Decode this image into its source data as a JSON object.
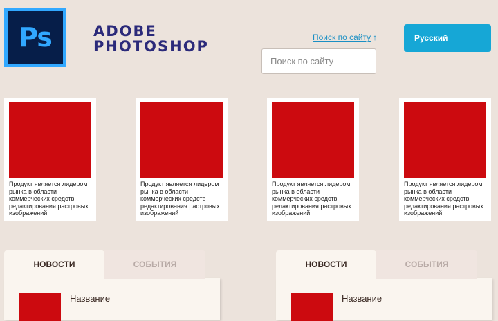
{
  "header": {
    "logo_text": "Ps",
    "brand_line1": "ADOBE",
    "brand_line2": "PHOTOSHOP",
    "search_link": "Поиск по сайту",
    "search_arrow": "↑",
    "search_placeholder": "Поиск по сайту",
    "language_button": "Русский"
  },
  "cards": [
    {
      "text": "Продукт является лидером рынка в области коммерческих средств редактирования растровых изображений"
    },
    {
      "text": "Продукт является лидером рынка в области коммерческих средств редактирования растровых изображений"
    },
    {
      "text": "Продукт является лидером рынка в области коммерческих средств редактирования растровых изображений"
    },
    {
      "text": "Продукт является лидером рынка в области коммерческих средств редактирования растровых изображений"
    }
  ],
  "tab_blocks": [
    {
      "tab_news": "НОВОСТИ",
      "tab_events": "СОБЫТИЯ",
      "item_title": "Название",
      "item_sub": "..."
    },
    {
      "tab_news": "НОВОСТИ",
      "tab_events": "СОБЫТИЯ",
      "item_title": "Название",
      "item_sub": "..."
    }
  ],
  "colors": {
    "background": "#ece3dc",
    "accent": "#16a7d6",
    "placeholder_red": "#cc0a0f",
    "brand": "#2b2a7a"
  }
}
